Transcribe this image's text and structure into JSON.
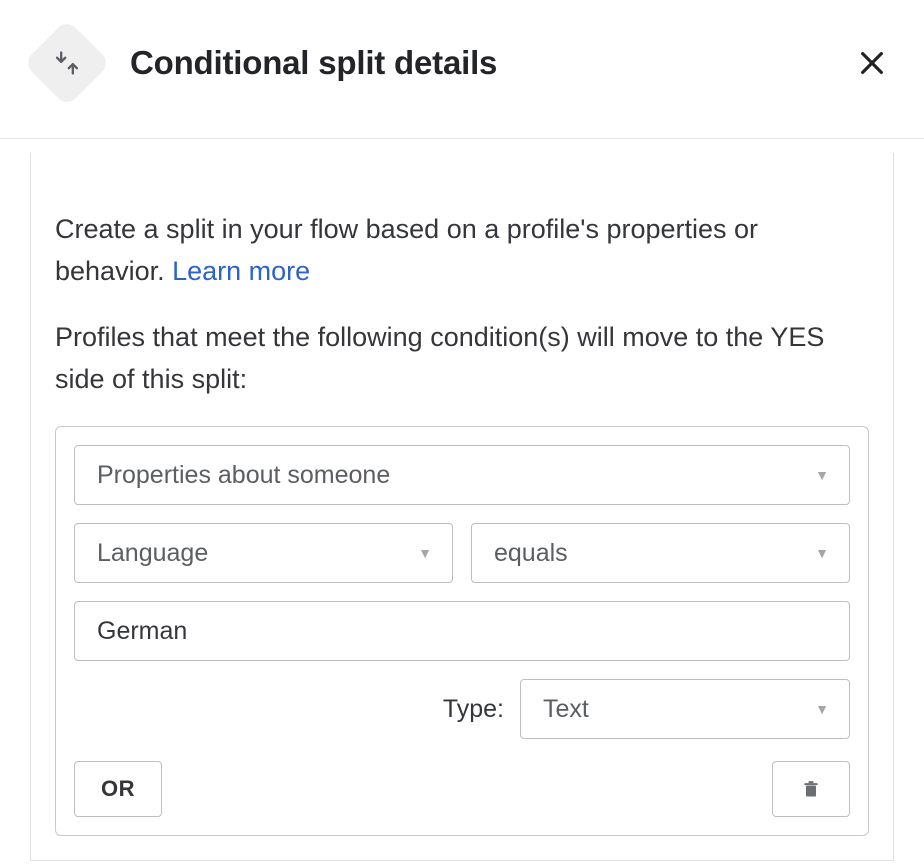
{
  "header": {
    "title": "Conditional split details"
  },
  "intro": {
    "text": "Create a split in your flow based on a profile's properties or behavior. ",
    "learn_more": "Learn more"
  },
  "subtext": "Profiles that meet the following condition(s) will move to the YES side of this split:",
  "condition": {
    "category": "Properties about someone",
    "property": "Language",
    "operator": "equals",
    "value": "German",
    "type_label": "Type:",
    "type_value": "Text"
  },
  "buttons": {
    "or": "OR"
  }
}
